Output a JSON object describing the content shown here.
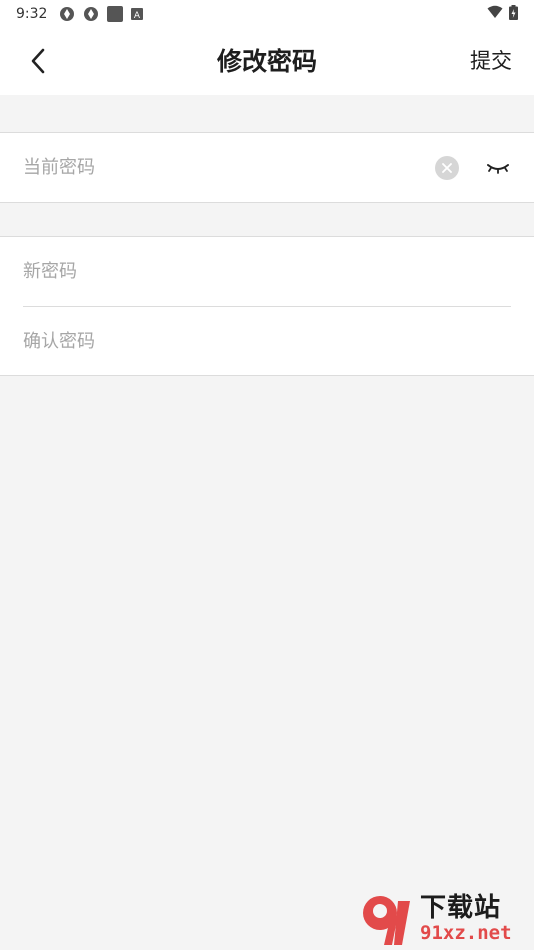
{
  "status_bar": {
    "time": "9:32"
  },
  "app_bar": {
    "back_icon": "chevron-left-icon",
    "title": "修改密码",
    "submit_label": "提交"
  },
  "current_password": {
    "placeholder": "当前密码",
    "value": ""
  },
  "new_password": {
    "placeholder": "新密码",
    "value": ""
  },
  "confirm_password": {
    "placeholder": "确认密码",
    "value": ""
  },
  "watermark": {
    "logo_text": "91",
    "cn_text": "下载站",
    "url_text": "91xz.net"
  },
  "colors": {
    "background": "#f4f4f4",
    "surface": "#ffffff",
    "divider": "#dcdcdc",
    "placeholder": "#a6a6a6",
    "watermark_red": "#e24a4a"
  }
}
